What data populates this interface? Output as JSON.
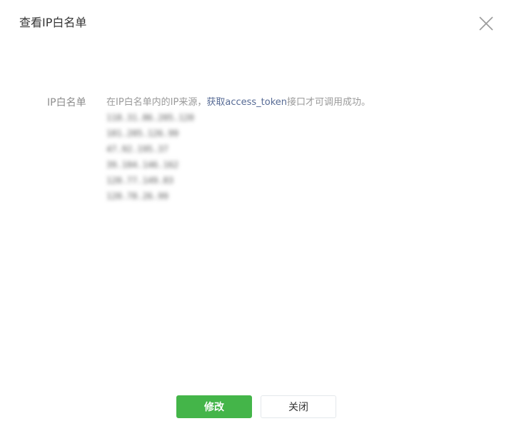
{
  "dialog": {
    "title": "查看IP白名单",
    "close_icon": "close-icon"
  },
  "whitelist": {
    "label": "IP白名单",
    "desc_prefix": "在IP白名单内的IP来源，",
    "desc_link": "获取access_token",
    "desc_suffix": "接口才可调用成功。",
    "ips": [
      "118.31.86.205.120",
      "101.205.126.99",
      "47.92.195.37",
      "39.104.146.162",
      "120.77.149.83",
      "120.78.26.99"
    ]
  },
  "buttons": {
    "edit_label": "修改",
    "close_label": "关闭"
  },
  "colors": {
    "primary": "#44b549",
    "link": "#576b95"
  }
}
